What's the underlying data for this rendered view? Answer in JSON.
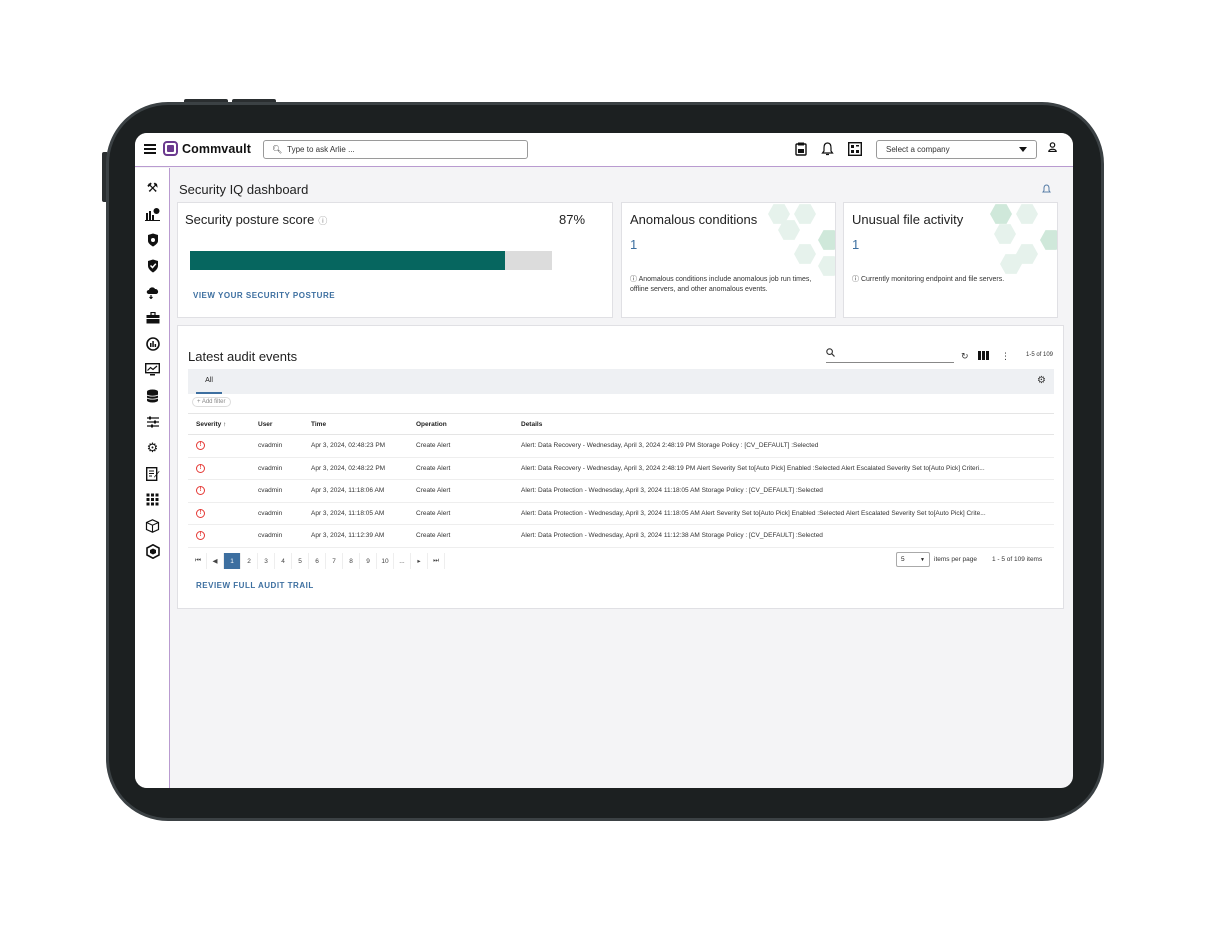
{
  "header": {
    "brand": "Commvault",
    "search_placeholder": "Type to ask Arlie ...",
    "company_select": "Select a company"
  },
  "page": {
    "title": "Security IQ dashboard"
  },
  "posture": {
    "title": "Security posture score",
    "percent_label": "87%",
    "percent_value": 0.87,
    "link": "VIEW YOUR SECURITY POSTURE"
  },
  "anomalous": {
    "title": "Anomalous conditions",
    "value": "1",
    "note": "Anomalous conditions include anomalous job run times, offline servers, and other anomalous events."
  },
  "unusual": {
    "title": "Unusual file activity",
    "value": "1",
    "note": "Currently monitoring endpoint and file servers."
  },
  "audit": {
    "title": "Latest audit events",
    "count_label": "1-5 of 109",
    "tab": "All",
    "add_filter": "+ Add filter",
    "columns": [
      "Severity",
      "User",
      "Time",
      "Operation",
      "Details"
    ],
    "rows": [
      {
        "user": "cvadmin",
        "time": "Apr 3, 2024, 02:48:23 PM",
        "operation": "Create Alert",
        "details": "Alert: Data Recovery - Wednesday, April 3, 2024 2:48:19 PM Storage Policy : [CV_DEFAULT] :Selected"
      },
      {
        "user": "cvadmin",
        "time": "Apr 3, 2024, 02:48:22 PM",
        "operation": "Create Alert",
        "details": "Alert: Data Recovery - Wednesday, April 3, 2024 2:48:19 PM Alert Severity Set to[Auto Pick] Enabled :Selected Alert Escalated Severity Set to[Auto Pick] Criteri..."
      },
      {
        "user": "cvadmin",
        "time": "Apr 3, 2024, 11:18:06 AM",
        "operation": "Create Alert",
        "details": "Alert: Data Protection - Wednesday, April 3, 2024 11:18:05 AM Storage Policy : [CV_DEFAULT] :Selected"
      },
      {
        "user": "cvadmin",
        "time": "Apr 3, 2024, 11:18:05 AM",
        "operation": "Create Alert",
        "details": "Alert: Data Protection - Wednesday, April 3, 2024 11:18:05 AM Alert Severity Set to[Auto Pick] Enabled :Selected Alert Escalated Severity Set to[Auto Pick] Crite..."
      },
      {
        "user": "cvadmin",
        "time": "Apr 3, 2024, 11:12:39 AM",
        "operation": "Create Alert",
        "details": "Alert: Data Protection - Wednesday, April 3, 2024 11:12:38 AM Storage Policy : [CV_DEFAULT] :Selected"
      }
    ],
    "pages": [
      "1",
      "2",
      "3",
      "4",
      "5",
      "6",
      "7",
      "8",
      "9",
      "10",
      "..."
    ],
    "current_page": "1",
    "per_page": "5",
    "per_page_label": "items per page",
    "items_count": "1 - 5 of 109 items",
    "review_link": "REVIEW FULL AUDIT TRAIL"
  },
  "colors": {
    "accent": "#3d6fa0",
    "brand": "#6b3a8f",
    "posture_bar": "#06665f",
    "severity": "#e53935"
  }
}
